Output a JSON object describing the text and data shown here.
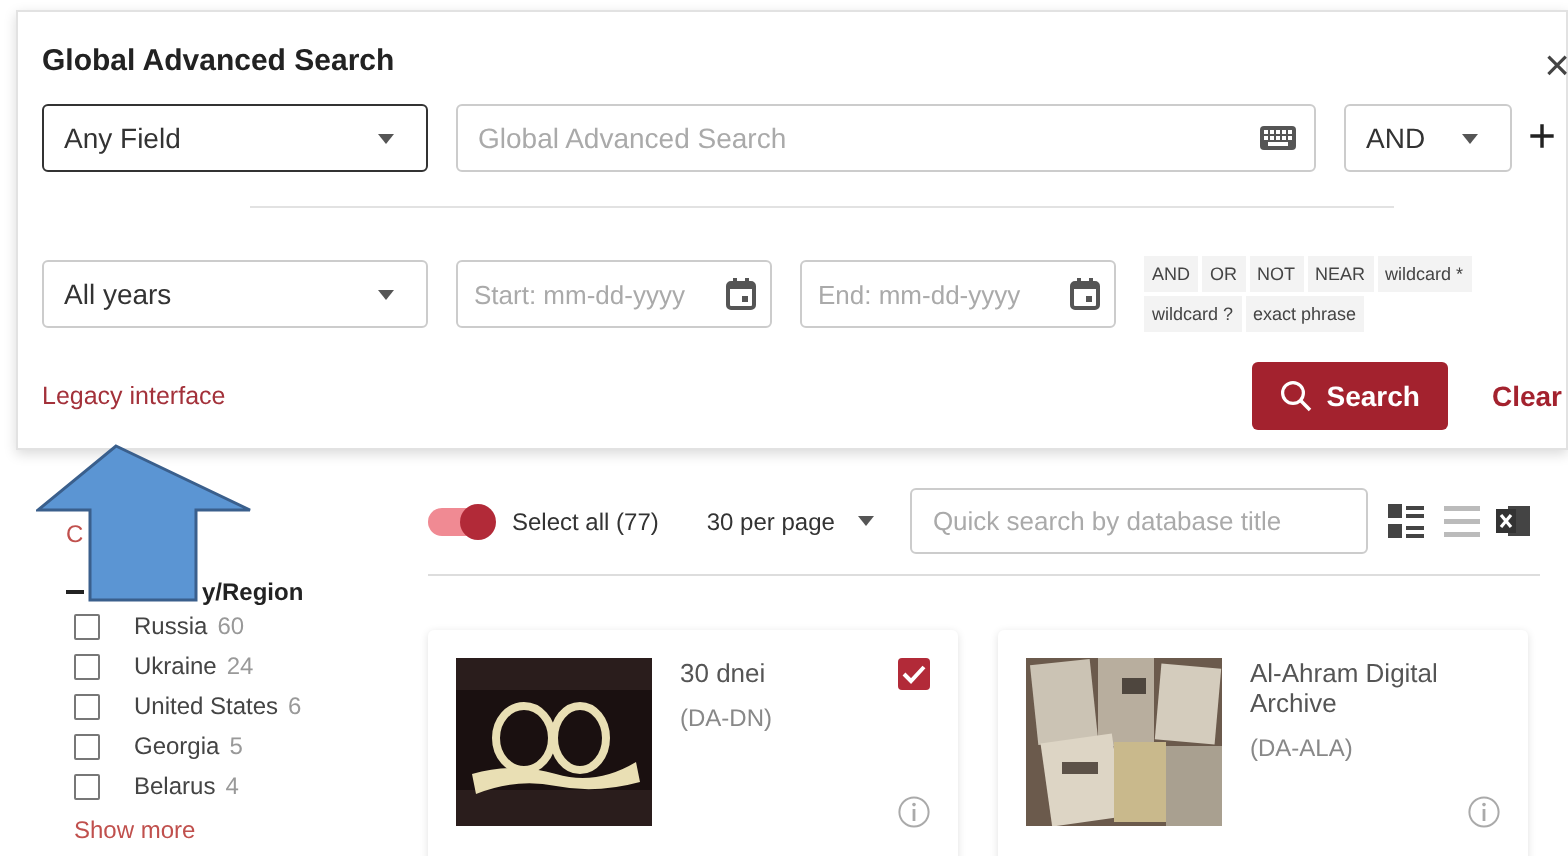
{
  "dialog": {
    "title": "Global Advanced Search",
    "close": "×",
    "field_select": {
      "value": "Any Field",
      "focused": true
    },
    "search_field": {
      "placeholder": "Global Advanced Search"
    },
    "operator_select": {
      "value": "AND"
    },
    "add": "+",
    "year_select": {
      "value": "All years"
    },
    "start_date": {
      "placeholder": "Start: mm-dd-yyyy"
    },
    "end_date": {
      "placeholder": "End: mm-dd-yyyy"
    },
    "operator_chips": [
      "AND",
      "OR",
      "NOT",
      "NEAR",
      "wildcard *",
      "wildcard ?",
      "exact phrase"
    ],
    "legacy_link": "Legacy interface",
    "search_button": "Search",
    "clear_button": "Clear"
  },
  "sidebar": {
    "link": "C",
    "facet": {
      "title": "y/Region",
      "expanded": true,
      "items": [
        {
          "label": "Russia",
          "count": "60",
          "checked": false
        },
        {
          "label": "Ukraine",
          "count": "24",
          "checked": false
        },
        {
          "label": "United States",
          "count": "6",
          "checked": false
        },
        {
          "label": "Georgia",
          "count": "5",
          "checked": false
        },
        {
          "label": "Belarus",
          "count": "4",
          "checked": false
        }
      ],
      "show_more": "Show more"
    }
  },
  "toolbar": {
    "select_all": {
      "label": "Select all (77)",
      "on": true
    },
    "per_page": "30 per page",
    "quick_search": {
      "placeholder": "Quick search by database title"
    },
    "views": [
      {
        "kind": "grid",
        "selected": true
      },
      {
        "kind": "list",
        "selected": false
      }
    ]
  },
  "cards": [
    {
      "title": "30 dnei",
      "code": "(DA-DN)",
      "checked": true
    },
    {
      "title": "Al-Ahram Digital Archive",
      "code": "(DA-ALA)",
      "checked": false
    }
  ]
}
